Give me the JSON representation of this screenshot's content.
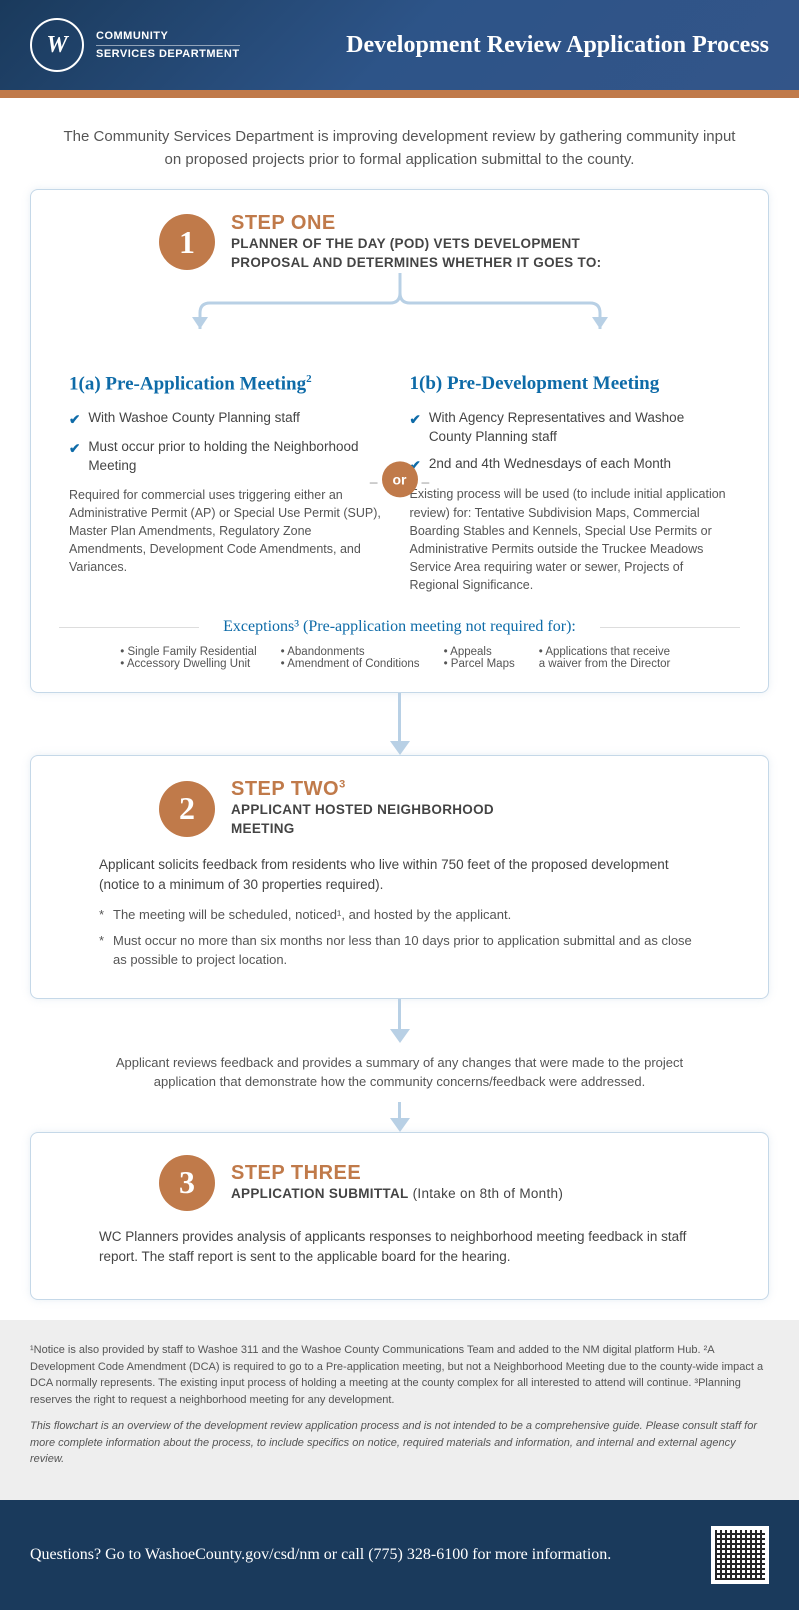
{
  "header": {
    "dept_line1": "COMMUNITY",
    "dept_line2": "SERVICES DEPARTMENT",
    "title": "Development Review Application Process",
    "seal_letter": "W"
  },
  "intro": "The Community Services Department is improving development review by gathering community input on proposed projects prior to formal application submittal to the county.",
  "step1": {
    "number": "1",
    "title": "STEP ONE",
    "subtitle": "PLANNER OF THE DAY (POD) VETS DEVELOPMENT PROPOSAL AND DETERMINES WHETHER IT GOES TO:",
    "branch_a": {
      "title": "1(a) Pre-Application Meeting",
      "title_sup": "2",
      "checks": [
        "With Washoe County Planning staff",
        "Must occur prior to holding the Neighborhood Meeting"
      ],
      "desc": "Required for commercial uses triggering either an Administrative Permit (AP) or Special Use Permit (SUP), Master Plan Amendments, Regulatory Zone Amendments, Development Code Amendments, and Variances."
    },
    "or": "or",
    "branch_b": {
      "title": "1(b) Pre-Development Meeting",
      "checks": [
        "With Agency Representatives and Washoe County Planning staff",
        "2nd and 4th Wednesdays of each Month"
      ],
      "desc": "Existing process will be used (to include initial application review) for: Tentative Subdivision Maps, Commercial Boarding Stables and Kennels, Special Use Permits or Administrative Permits outside the Truckee Meadows Service Area requiring water or sewer, Projects of Regional Significance."
    },
    "exceptions": {
      "title": "Exceptions³ (Pre-application meeting not required for):",
      "cols": [
        [
          "Single Family Residential",
          "Accessory Dwelling Unit"
        ],
        [
          "Abandonments",
          "Amendment of Conditions"
        ],
        [
          "Appeals",
          "Parcel Maps"
        ],
        [
          "Applications that receive a waiver from the Director"
        ]
      ]
    }
  },
  "step2": {
    "number": "2",
    "title": "STEP TWO",
    "title_sup": "3",
    "subtitle": "APPLICANT HOSTED NEIGHBORHOOD MEETING",
    "body": "Applicant solicits feedback from residents who live within 750 feet of the proposed development (notice to a minimum of 30 properties required).",
    "stars": [
      "The meeting will be scheduled, noticed¹, and hosted by the applicant.",
      "Must occur no more than six months nor less than 10 days prior to application submittal and as close as possible to project location."
    ]
  },
  "interstitial": "Applicant reviews feedback and provides a summary of any changes that were made to the project application that demonstrate how the community concerns/feedback were addressed.",
  "step3": {
    "number": "3",
    "title": "STEP THREE",
    "subtitle": "APPLICATION SUBMITTAL",
    "subtitle_extra": " (Intake on 8th of Month)",
    "body": "WC Planners provides analysis of applicants responses to neighborhood meeting feedback in staff report. The staff report is sent to the applicable board for the hearing."
  },
  "footnotes": {
    "p1": "¹Notice is also provided by staff to Washoe 311 and the Washoe County Communications Team and added to the NM digital platform Hub. ²A Development Code Amendment (DCA) is required to go to a Pre-application meeting, but not a Neighborhood Meeting due to the county-wide impact a DCA normally represents. The existing input process of holding a meeting at the county complex for all interested to attend will continue. ³Planning reserves the right to request a neighborhood meeting for any development.",
    "p2": "This flowchart is an overview of the development review application process and is not intended to be a comprehensive guide. Please consult staff for more complete information about the process, to include specifics on notice, required materials and information, and internal and external agency review."
  },
  "footer": {
    "text": "Questions? Go to WashoeCounty.gov/csd/nm or call (775) 328-6100 for more information."
  }
}
